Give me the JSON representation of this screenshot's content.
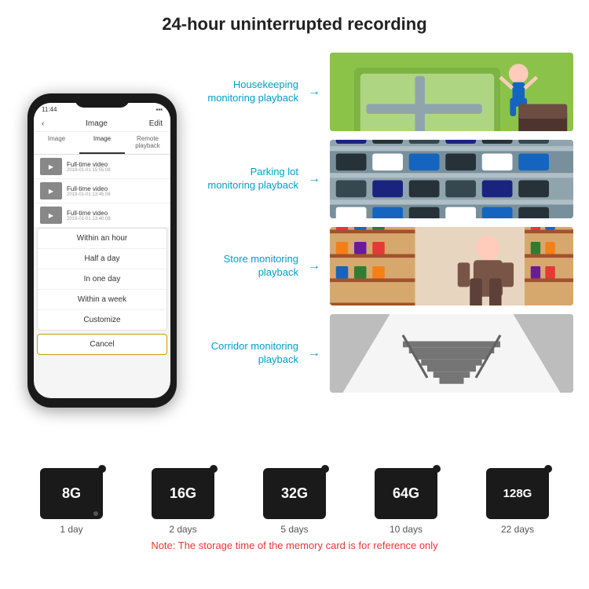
{
  "header": {
    "title": "24-hour uninterrupted recording"
  },
  "phone": {
    "status_time": "11:44",
    "screen_title": "Image",
    "screen_edit": "Edit",
    "tabs": [
      "Image",
      "Image",
      "Remote playback"
    ],
    "list_items": [
      {
        "label": "Full-time video",
        "time": "2019-01-01 15:55:08"
      },
      {
        "label": "Full-time video",
        "time": "2019-01-01 13:45:08"
      },
      {
        "label": "Full-time video",
        "time": "2019-01-01 13:40:08"
      }
    ],
    "dropdown": {
      "items": [
        "Within an hour",
        "Half a day",
        "In one day",
        "Within a week",
        "Customize"
      ],
      "cancel": "Cancel"
    }
  },
  "monitoring": [
    {
      "label": "Housekeeping\nmonitoring playback",
      "photo_alt": "child playing on floor mat"
    },
    {
      "label": "Parking lot\nmonitoring playback",
      "photo_alt": "parking lot aerial view"
    },
    {
      "label": "Store monitoring\nplayback",
      "photo_alt": "store interior"
    },
    {
      "label": "Corridor monitoring\nplayback",
      "photo_alt": "corridor stairs"
    }
  ],
  "memory_cards": [
    {
      "size": "8G",
      "days": "1 day"
    },
    {
      "size": "16G",
      "days": "2 days"
    },
    {
      "size": "32G",
      "days": "5 days"
    },
    {
      "size": "64G",
      "days": "10 days"
    },
    {
      "size": "128G",
      "days": "22 days"
    }
  ],
  "note": "Note: The storage time of the memory card is for reference only"
}
